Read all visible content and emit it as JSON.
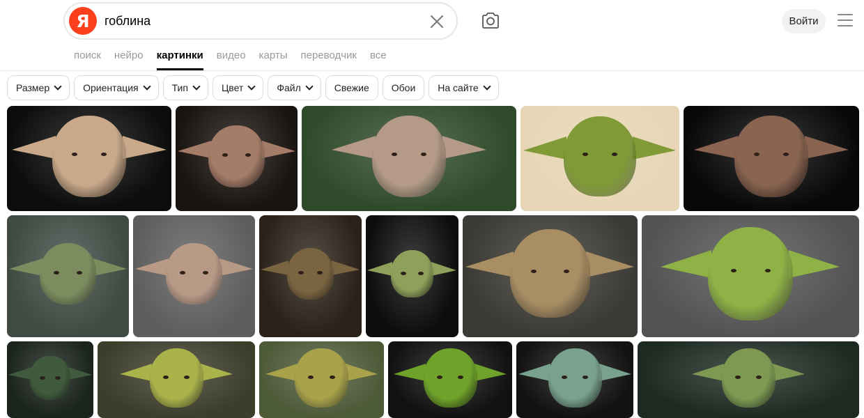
{
  "search": {
    "logo_letter": "Я",
    "query": "гоблина"
  },
  "header": {
    "login_label": "Войти"
  },
  "tabs": [
    {
      "label": "поиск",
      "active": false
    },
    {
      "label": "нейро",
      "active": false
    },
    {
      "label": "картинки",
      "active": true
    },
    {
      "label": "видео",
      "active": false
    },
    {
      "label": "карты",
      "active": false
    },
    {
      "label": "переводчик",
      "active": false
    },
    {
      "label": "все",
      "active": false
    }
  ],
  "filters": [
    {
      "label": "Размер",
      "dropdown": true
    },
    {
      "label": "Ориентация",
      "dropdown": true
    },
    {
      "label": "Тип",
      "dropdown": true
    },
    {
      "label": "Цвет",
      "dropdown": true
    },
    {
      "label": "Файл",
      "dropdown": true
    },
    {
      "label": "Свежие",
      "dropdown": false
    },
    {
      "label": "Обои",
      "dropdown": false
    },
    {
      "label": "На сайте",
      "dropdown": true
    }
  ],
  "colors": {
    "brand_red": "#fc3f1d",
    "active_tab": "#000000",
    "inactive_tab": "#999999"
  }
}
